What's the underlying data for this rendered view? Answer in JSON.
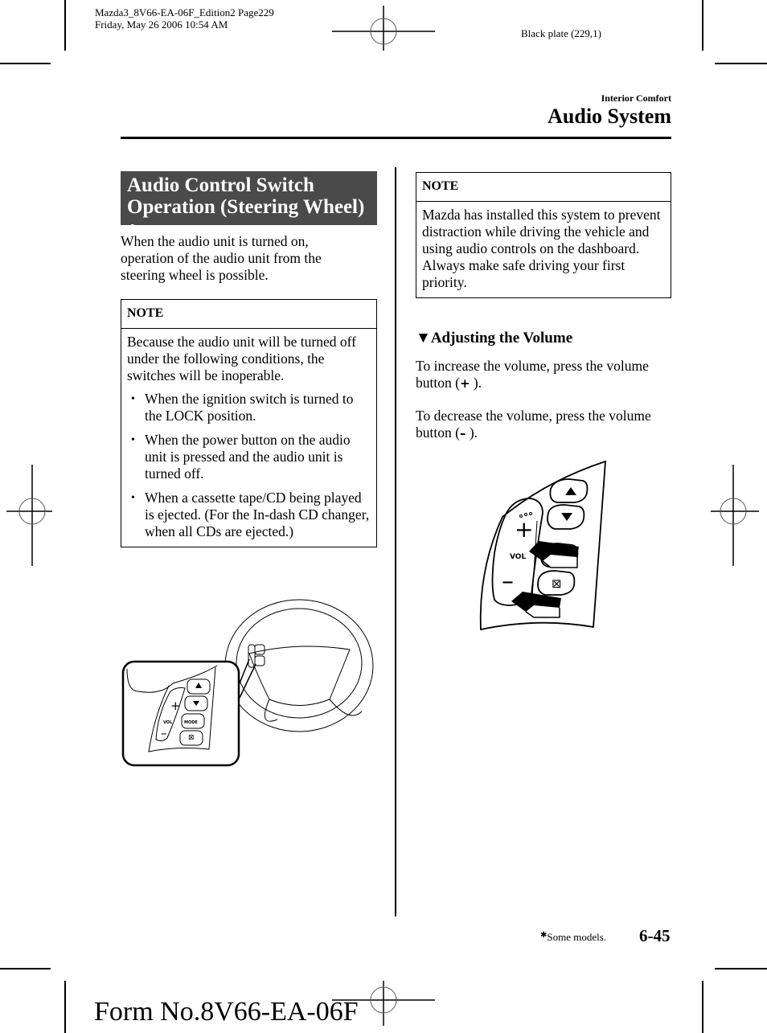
{
  "print_meta": {
    "file_line": "Mazda3_8V66-EA-06F_Edition2 Page229",
    "date_line": "Friday, May 26 2006 10:54 AM",
    "plate": "Black plate (229,1)"
  },
  "header": {
    "section": "Interior Comfort",
    "chapter": "Audio System"
  },
  "left_column": {
    "title_line1": "Audio Control Switch",
    "title_line2": "Operation (Steering Wheel)",
    "title_marker": "✱",
    "intro": "When the audio unit is turned on, operation of the audio unit from the steering wheel is possible.",
    "note": {
      "heading": "NOTE",
      "text": "Because the audio unit will be turned off under the following conditions, the switches will be inoperable.",
      "bullets": [
        "When the ignition switch is turned to the LOCK position.",
        "When the power button on the audio unit is pressed and the audio unit is turned off.",
        "When a cassette tape/CD being played is ejected. (For the In-dash CD changer, when all CDs are ejected.)"
      ],
      "bullet_glyph": "•"
    },
    "illustration": {
      "description": "steering-wheel-with-audio-switch-detail",
      "labels": {
        "plus": "+",
        "minus": "–",
        "vol": "VOL",
        "mode": "MODE"
      }
    }
  },
  "right_column": {
    "note": {
      "heading": "NOTE",
      "line1": "Mazda has installed this system to prevent distraction while driving the vehicle and using audio controls on the dashboard.",
      "line2": "Always make safe driving your first priority."
    },
    "subsection": {
      "marker": "▼",
      "title": "Adjusting the Volume",
      "increase_prefix": "To increase the volume, press the volume button (",
      "increase_symbol": "+",
      "increase_suffix": " ).",
      "decrease_prefix": "To decrease the volume, press the volume button (",
      "decrease_symbol": "–",
      "decrease_suffix": " )."
    },
    "illustration": {
      "description": "volume-switch-closeup-with-arrows",
      "labels": {
        "plus": "+",
        "minus": "–",
        "vol": "VOL"
      }
    }
  },
  "footer": {
    "footnote_marker": "✱",
    "footnote": "Some models.",
    "page_number": "6-45",
    "form_number": "Form No.8V66-EA-06F"
  }
}
